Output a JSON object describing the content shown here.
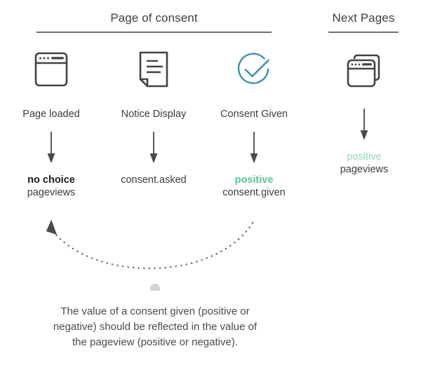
{
  "headers": [
    {
      "id": "page-of-consent",
      "label": "Page of consent"
    },
    {
      "id": "next-pages",
      "label": "Next Pages"
    }
  ],
  "columns": [
    {
      "id": "page-loaded",
      "icon": "browser-window-icon",
      "step_label": "Page loaded",
      "arrow": "down-arrow-icon",
      "value_primary": "no choice",
      "value_primary_style": "bold-black",
      "value_secondary": "pageviews"
    },
    {
      "id": "notice-display",
      "icon": "note-document-icon",
      "step_label": "Notice Display",
      "arrow": "down-arrow-icon",
      "value_primary": "consent.asked",
      "value_primary_style": "plain",
      "value_secondary": ""
    },
    {
      "id": "consent-given",
      "icon": "circle-check-icon",
      "step_label": "Consent Given",
      "arrow": "down-arrow-icon",
      "value_primary": "positive",
      "value_primary_style": "bold-green",
      "value_secondary": "consent.given"
    },
    {
      "id": "next-pageviews",
      "icon": "stacked-browser-windows-icon",
      "step_label": "",
      "arrow": "down-arrow-icon",
      "value_primary": "positive",
      "value_primary_style": "light-green",
      "value_secondary": "pageviews"
    }
  ],
  "feedback": {
    "curve_icon": "dotted-curved-arrow",
    "marker_icon": "curve-midpoint-dot",
    "arrowhead_icon": "arrowhead-up-left-icon"
  },
  "caption": {
    "text": "The value of a consent given (positive or negative) should be reflected in the value of the pageview (positive or negative)."
  },
  "colors": {
    "ink": "#3c3c3c",
    "rule": "#6e6e6e",
    "teal": "#3a8fa4",
    "green_bold": "#58c396",
    "green_light": "#92d8b7",
    "dot": "#d2d2d2",
    "arrow": "#4a4a4a"
  }
}
